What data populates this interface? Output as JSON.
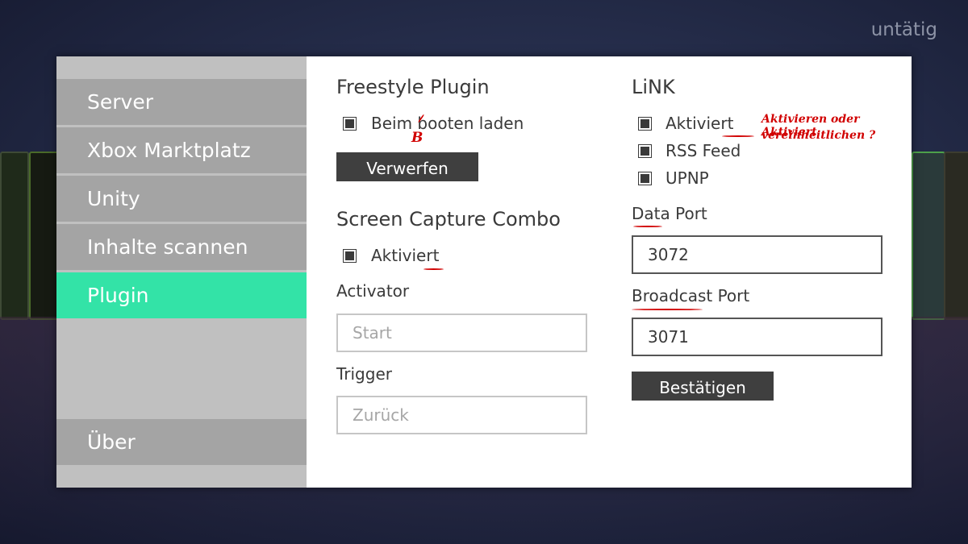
{
  "status": "untätig",
  "sidebar": {
    "items": [
      {
        "label": "Server",
        "active": false
      },
      {
        "label": "Xbox Marktplatz",
        "active": false
      },
      {
        "label": "Unity",
        "active": false
      },
      {
        "label": "Inhalte scannen",
        "active": false
      },
      {
        "label": "Plugin",
        "active": true
      }
    ],
    "bottom_item": {
      "label": "Über"
    }
  },
  "freestyle_plugin": {
    "title": "Freestyle Plugin",
    "checkbox_label": "Beim booten laden",
    "checked": true,
    "button_label": "Verwerfen"
  },
  "screen_capture": {
    "title": "Screen Capture Combo",
    "checkbox_label": "Aktiviert",
    "checked": true,
    "activator_label": "Activator",
    "activator_placeholder": "Start",
    "trigger_label": "Trigger",
    "trigger_placeholder": "Zurück"
  },
  "link": {
    "title": "LiNK",
    "options": [
      {
        "label": "Aktiviert",
        "checked": true
      },
      {
        "label": "RSS Feed",
        "checked": true
      },
      {
        "label": "UPNP",
        "checked": true
      }
    ],
    "data_port_label": "Data Port",
    "data_port_value": "3072",
    "broadcast_port_label": "Broadcast Port",
    "broadcast_port_value": "3071",
    "confirm_label": "Bestätigen"
  },
  "annotations": {
    "b_correction": "B",
    "note_line1": "Aktivieren oder Aktiviert",
    "note_line2": "vereinheitlichen ?"
  },
  "colors": {
    "active_nav": "#33e3a7",
    "nav_item": "#a4a4a4",
    "sidebar": "#c0c0c0",
    "button": "#3f3f3f",
    "annotation": "#d10000"
  }
}
